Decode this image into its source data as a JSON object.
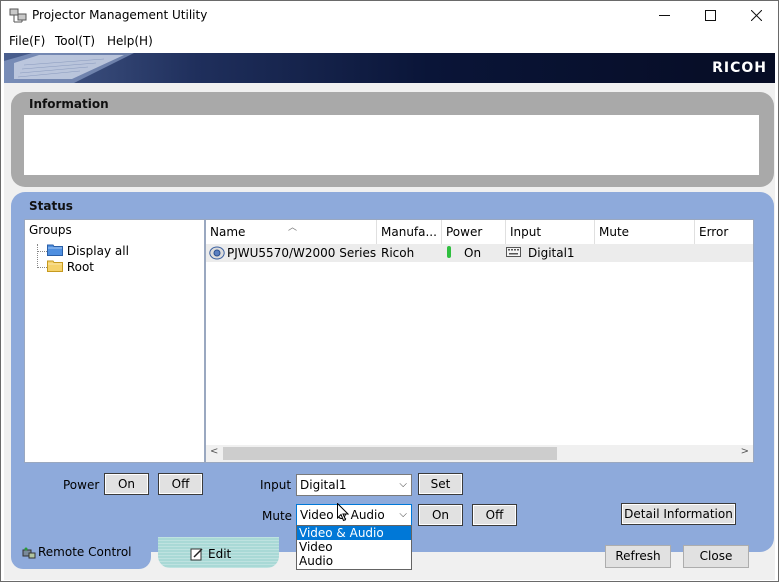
{
  "window": {
    "title": "Projector Management Utility",
    "icon": "projector-network-icon",
    "controls": {
      "minimize": "minimize-icon",
      "maximize": "maximize-icon",
      "close": "close-icon"
    }
  },
  "menu": [
    {
      "label": "File(F)"
    },
    {
      "label": "Tool(T)"
    },
    {
      "label": "Help(H)"
    }
  ],
  "banner": {
    "logo": "RICOH"
  },
  "information": {
    "title": "Information"
  },
  "status": {
    "title": "Status",
    "groups": {
      "header": "Groups",
      "items": [
        {
          "label": "Display all",
          "icon": "folder-blue-icon"
        },
        {
          "label": "Root",
          "icon": "folder-yellow-icon"
        }
      ]
    },
    "columns": [
      "Name",
      "Manufa...",
      "Power",
      "Input",
      "Mute",
      "Error"
    ],
    "rows": [
      {
        "name": "PJWU5570/W2000 Series",
        "manufacturer": "Ricoh",
        "power": "On",
        "input": "Digital1",
        "mute": "",
        "error": ""
      }
    ]
  },
  "controls": {
    "power_label": "Power",
    "power_on": "On",
    "power_off": "Off",
    "input_label": "Input",
    "input_value": "Digital1",
    "set_label": "Set",
    "mute_label": "Mute",
    "mute_value": "Video & Audio",
    "mute_options": [
      "Video & Audio",
      "Video",
      "Audio"
    ],
    "mute_on": "On",
    "mute_off": "Off",
    "detail_label": "Detail Information",
    "refresh_label": "Refresh",
    "close_label": "Close"
  },
  "tabs": [
    {
      "label": "Remote Control",
      "icon": "remote-control-icon",
      "active": true
    },
    {
      "label": "Edit",
      "icon": "edit-icon",
      "active": false
    }
  ],
  "colors": {
    "panel_blue": "#8eaadb",
    "panel_gray": "#a9a9a9",
    "tab_edit": "#a9d9d6",
    "selection": "#0078d7"
  }
}
